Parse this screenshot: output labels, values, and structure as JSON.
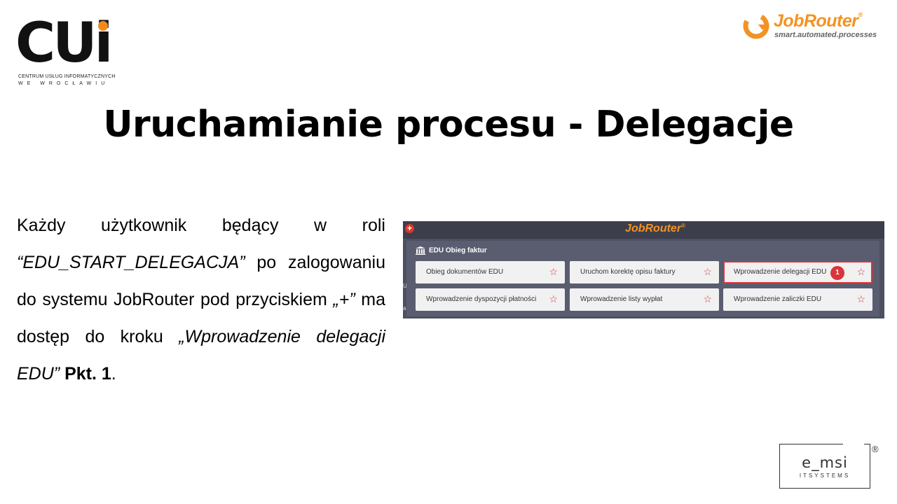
{
  "logos": {
    "cui": {
      "mark": "CUi",
      "line1": "CENTRUM USŁUG INFORMATYCZNYCH",
      "line2": "WE WROCŁAWIU"
    },
    "jobrouter": {
      "name": "JobRouter",
      "registered": "®",
      "tagline": "smart.automated.processes"
    },
    "emsi": {
      "name": "e_msi",
      "sub": "ITSYSTEMS",
      "registered": "®"
    }
  },
  "title": "Uruchamianie procesu - Delegacje",
  "body": {
    "p1": "Każdy użytkownik będący w roli ",
    "role": "“EDU_START_DELEGACJA”",
    "p2": " po zalogowaniu do systemu JobRouter pod przyciskiem ",
    "button": "„+”",
    "p3": " ma dostęp do kroku ",
    "step": "„Wprowadzenie delegacji EDU”",
    "p4": " ",
    "point": "Pkt. 1",
    "end": "."
  },
  "screenshot": {
    "plus": "+",
    "brand": "JobRouter",
    "brand_reg": "®",
    "side_text_1": "U",
    "side_text_2": "a",
    "group": "EDU Obieg faktur",
    "tiles": [
      {
        "label": "Obieg dokumentów EDU"
      },
      {
        "label": "Uruchom korektę opisu faktury"
      },
      {
        "label": "Wprowadzenie delegacji EDU",
        "badge": "1"
      },
      {
        "label": "Wprowadzenie dyspozycji płatności"
      },
      {
        "label": "Wprowadzenie listy wypłat"
      },
      {
        "label": "Wprowadzenie zaliczki EDU"
      }
    ],
    "star": "☆"
  },
  "colors": {
    "accent_orange": "#f39323",
    "highlight_red": "#d8363a",
    "panel_bg": "#4d5061",
    "tile_bg": "#f1f1f1"
  }
}
